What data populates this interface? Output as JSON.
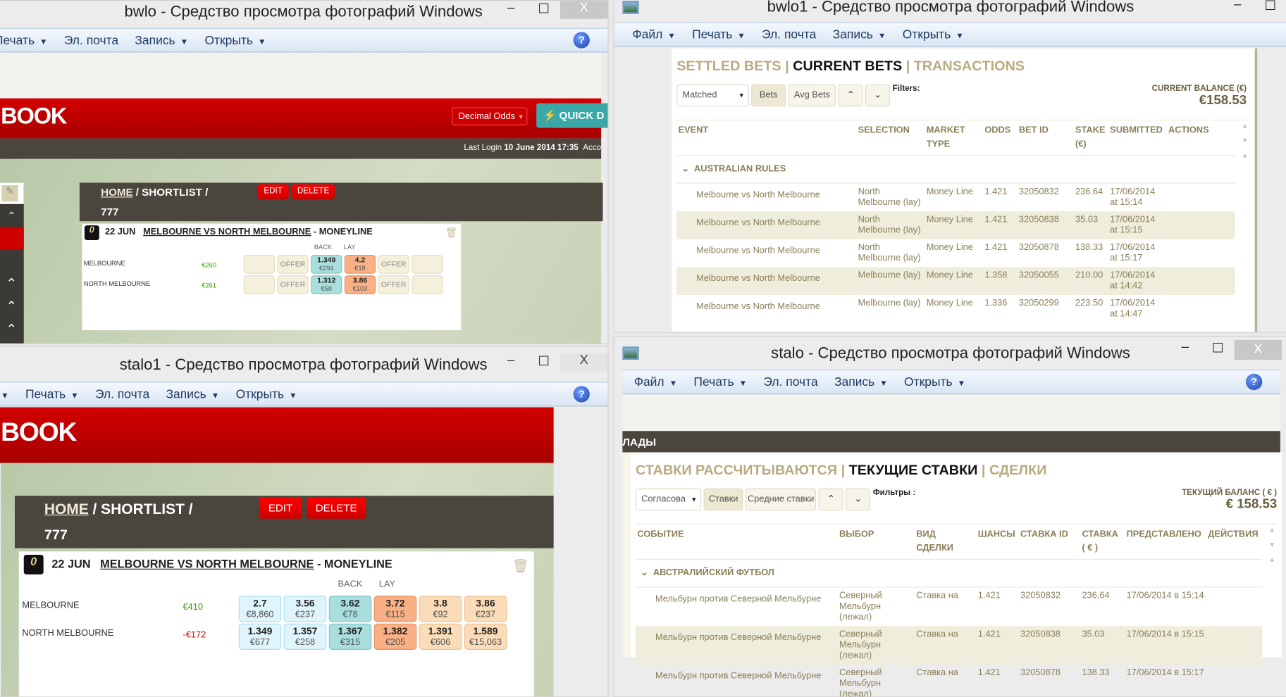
{
  "toolbar_menu": {
    "file": "Файл",
    "print": "Печать",
    "email": "Эл. почта",
    "record": "Запись",
    "open": "Открыть",
    "help": "?"
  },
  "window_controls": {
    "minimize": "–",
    "maximize": "☐",
    "close": "X"
  },
  "win_tl": {
    "title": "bwlo - Средство просмотра фотографий Windows",
    "logo": "BOOK",
    "odds_format": "Decimal Odds",
    "quick": "QUICK D",
    "last_login_label": "Last Login",
    "last_login_value": "10 June 2014 17:35",
    "account": "Acco",
    "breadcrumb": {
      "home": "HOME",
      "sep1": " / ",
      "shortlist": "SHORTLIST",
      "sep2": " /",
      "name": "777"
    },
    "edit": "EDIT",
    "delete": "DELETE",
    "market": {
      "date": "22 JUN",
      "title": "MELBOURNE VS NORTH MELBOURNE",
      "suffix": " - MONEYLINE",
      "back": "BACK",
      "lay": "LAY",
      "runners": [
        {
          "name": "MELBOURNE",
          "pl": "€260",
          "pl_color": "#3aa000",
          "cells": [
            {
              "t": "blank",
              "o": "",
              "a": ""
            },
            {
              "t": "offer",
              "o": "OFFER",
              "a": ""
            },
            {
              "t": "back2",
              "o": "1.349",
              "a": "€294"
            },
            {
              "t": "lay2",
              "o": "4.2",
              "a": "€18"
            },
            {
              "t": "offer",
              "o": "OFFER",
              "a": ""
            },
            {
              "t": "blank",
              "o": "",
              "a": ""
            }
          ]
        },
        {
          "name": "NORTH MELBOURNE",
          "pl": "€261",
          "pl_color": "#3aa000",
          "cells": [
            {
              "t": "blank",
              "o": "",
              "a": ""
            },
            {
              "t": "offer",
              "o": "OFFER",
              "a": ""
            },
            {
              "t": "back2",
              "o": "1.312",
              "a": "€58"
            },
            {
              "t": "lay2",
              "o": "3.86",
              "a": "€103"
            },
            {
              "t": "offer",
              "o": "OFFER",
              "a": ""
            },
            {
              "t": "blank",
              "o": "",
              "a": ""
            }
          ]
        }
      ]
    }
  },
  "win_bl": {
    "title": "stalo1 - Средство просмотра фотографий Windows",
    "logo": "BOOK",
    "breadcrumb": {
      "home": "HOME",
      "sep1": " / ",
      "shortlist": "SHORTLIST",
      "sep2": " /",
      "name": "777"
    },
    "edit": "EDIT",
    "delete": "DELETE",
    "market": {
      "date": "22 JUN",
      "title": "MELBOURNE VS NORTH MELBOURNE",
      "suffix": " - MONEYLINE",
      "back": "BACK",
      "lay": "LAY",
      "runners": [
        {
          "name": "MELBOURNE",
          "pl": "€410",
          "pl_color": "#3aa000",
          "cells": [
            {
              "t": "back",
              "o": "2.7",
              "a": "€8,860"
            },
            {
              "t": "back",
              "o": "3.56",
              "a": "€237"
            },
            {
              "t": "back2",
              "o": "3.62",
              "a": "€78"
            },
            {
              "t": "lay2",
              "o": "3.72",
              "a": "€115"
            },
            {
              "t": "lay",
              "o": "3.8",
              "a": "€92"
            },
            {
              "t": "lay",
              "o": "3.86",
              "a": "€237"
            }
          ]
        },
        {
          "name": "NORTH MELBOURNE",
          "pl": "-€172",
          "pl_color": "#e00000",
          "cells": [
            {
              "t": "back",
              "o": "1.349",
              "a": "€677"
            },
            {
              "t": "back",
              "o": "1.357",
              "a": "€258"
            },
            {
              "t": "back2",
              "o": "1.367",
              "a": "€315"
            },
            {
              "t": "lay2",
              "o": "1.382",
              "a": "€205"
            },
            {
              "t": "lay",
              "o": "1.391",
              "a": "€606"
            },
            {
              "t": "lay",
              "o": "1.589",
              "a": "€15,063"
            }
          ]
        }
      ]
    }
  },
  "win_tr": {
    "title": "bwlo1 - Средство просмотра фотографий Windows",
    "tabs": {
      "settled": "SETTLED BETS",
      "current": "CURRENT BETS",
      "transactions": "TRANSACTIONS",
      "sep": "|"
    },
    "filter_select": "Matched",
    "bets_btn": "Bets",
    "avg_btn": "Avg Bets",
    "filters": "Filters:",
    "balance_label": "CURRENT BALANCE (€)",
    "balance": "€158.53",
    "columns": [
      "EVENT",
      "SELECTION",
      "MARKET TYPE",
      "ODDS",
      "BET ID",
      "STAKE (€)",
      "SUBMITTED",
      "ACTIONS"
    ],
    "group": "AUSTRALIAN RULES",
    "rows": [
      {
        "event": "Melbourne vs North Melbourne",
        "selection": "North Melbourne (lay)",
        "market": "Money Line",
        "odds": "1.421",
        "id": "32050832",
        "stake": "236.64",
        "submitted": "17/06/2014 at 15:14"
      },
      {
        "event": "Melbourne vs North Melbourne",
        "selection": "North Melbourne (lay)",
        "market": "Money Line",
        "odds": "1.421",
        "id": "32050838",
        "stake": "35.03",
        "submitted": "17/06/2014 at 15:15"
      },
      {
        "event": "Melbourne vs North Melbourne",
        "selection": "North Melbourne (lay)",
        "market": "Money Line",
        "odds": "1.421",
        "id": "32050878",
        "stake": "138.33",
        "submitted": "17/06/2014 at 15:17"
      },
      {
        "event": "Melbourne vs North Melbourne",
        "selection": "Melbourne (lay)",
        "market": "Money Line",
        "odds": "1.358",
        "id": "32050055",
        "stake": "210.00",
        "submitted": "17/06/2014 at 14:42"
      },
      {
        "event": "Melbourne vs North Melbourne",
        "selection": "Melbourne (lay)",
        "market": "Money Line",
        "odds": "1.336",
        "id": "32050299",
        "stake": "223.50",
        "submitted": "17/06/2014 at 14:47"
      }
    ]
  },
  "win_br": {
    "title": "stalo - Средство просмотра фотографий Windows",
    "dark_bar": "ЛАДЫ",
    "tabs": {
      "settled": "СТАВКИ РАССЧИТЫВАЮТСЯ",
      "current": "ТЕКУЩИЕ СТАВКИ",
      "transactions": "СДЕЛКИ",
      "sep": "|"
    },
    "filter_select": "Согласова",
    "bets_btn": "Ставки",
    "avg_btn": "Средние ставки",
    "filters": "Фильтры :",
    "balance_label": "ТЕКУЩИЙ БАЛАНС ( € )",
    "balance": "€ 158.53",
    "columns": [
      "СОБЫТИЕ",
      "ВЫБОР",
      "ВИД СДЕЛКИ",
      "ШАНСЫ",
      "СТАВКА ID",
      "СТАВКА ( € )",
      "ПРЕДСТАВЛЕНО",
      "ДЕЙСТВИЯ"
    ],
    "group": "АВСТРАЛИЙСКИЙ ФУТБОЛ",
    "rows": [
      {
        "event": "Мельбурн против Северной Мельбурне",
        "selection": "Северный Мельбурн (лежал)",
        "market": "Ставка на",
        "odds": "1.421",
        "id": "32050832",
        "stake": "236.64",
        "submitted": "17/06/2014 в 15:14"
      },
      {
        "event": "Мельбурн против Северной Мельбурне",
        "selection": "Северный Мельбурн (лежал)",
        "market": "Ставка на",
        "odds": "1.421",
        "id": "32050838",
        "stake": "35.03",
        "submitted": "17/06/2014 в 15:15"
      },
      {
        "event": "Мельбурн против Северной Мельбурне",
        "selection": "Северный Мельбурн (лежал)",
        "market": "Ставка на",
        "odds": "1.421",
        "id": "32050878",
        "stake": "138.33",
        "submitted": "17/06/2014 в 15:17"
      }
    ]
  }
}
